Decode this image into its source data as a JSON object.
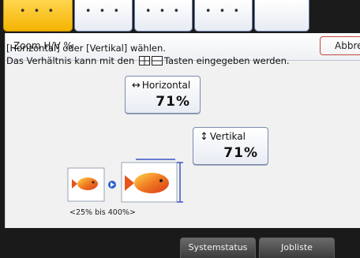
{
  "top_tabs": [
    {
      "label": "• • •",
      "active": true
    },
    {
      "label": "• • •",
      "active": false
    },
    {
      "label": "• • •",
      "active": false
    },
    {
      "label": "• • •",
      "active": false
    },
    {
      "label": "",
      "active": false
    }
  ],
  "dialog": {
    "title": "Zoom H/V %",
    "cancel_label": "Abbre",
    "instruction_line1": "[Horizontal] oder [Vertikal] wählen.",
    "instruction_line2_prefix": "Das Verhältnis kann mit den ",
    "instruction_line2_suffix": "Tasten eingegeben werden."
  },
  "horizontal": {
    "arrow": "↔",
    "label": "Horizontal",
    "value": "71%"
  },
  "vertical": {
    "arrow": "↕",
    "label": "Vertikal",
    "value": "71%"
  },
  "range_text": "<25% bis 400%>",
  "bottom": {
    "system_status": "Systemstatus",
    "job_list": "Jobliste"
  },
  "colors": {
    "active_tab": "#f4b400",
    "accent_border": "#c24a3d",
    "fish": "#e8541b"
  }
}
